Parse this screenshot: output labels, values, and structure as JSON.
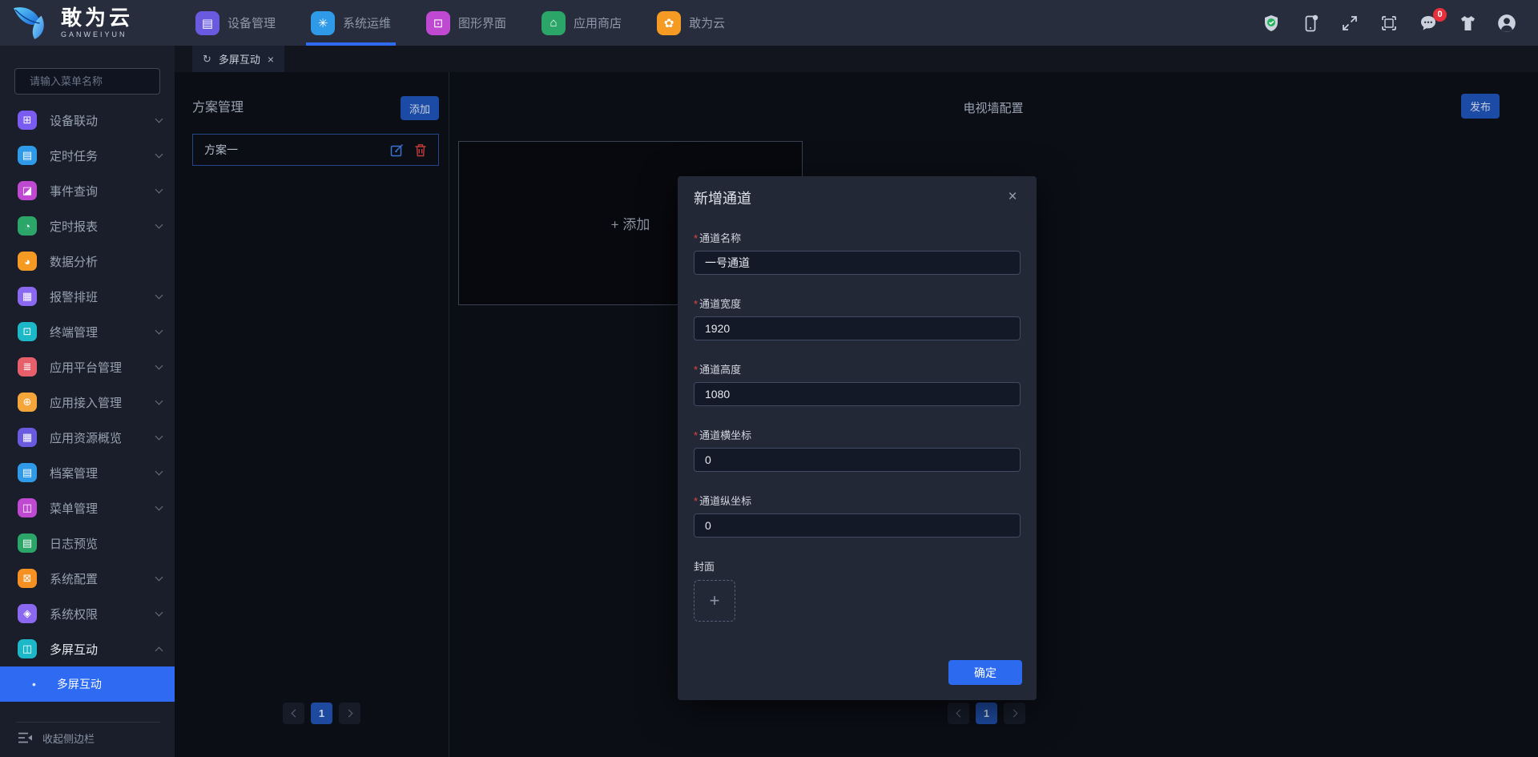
{
  "glyphs": {
    "asterisk": "*",
    "close": "×",
    "plus": "+",
    "refresh": "↻",
    "bullet": "•",
    "tab_close": "×"
  },
  "colors": {
    "accent": "#2e6bf2",
    "primary_button": "#1c4ba6",
    "confirm_button": "#2c6af0",
    "badge": "#e8303c",
    "required": "#e8463c",
    "page_active": "#1d4a9e"
  },
  "navbar": {
    "brand": {
      "title": "敢为云",
      "subtitle": "GANWEIYUN"
    },
    "items": [
      {
        "label": "设备管理",
        "glyph": "▤",
        "color": "#6a5ae0"
      },
      {
        "label": "系统运维",
        "glyph": "✳",
        "color": "#2f9ae8",
        "active": true
      },
      {
        "label": "图形界面",
        "glyph": "⊡",
        "color": "#bf4ad1"
      },
      {
        "label": "应用商店",
        "glyph": "⌂",
        "color": "#2ba568"
      },
      {
        "label": "敢为云",
        "glyph": "✿",
        "color": "#f59a23"
      }
    ],
    "message_badge": "0"
  },
  "sidebar": {
    "search_placeholder": "请输入菜单名称",
    "items": [
      {
        "label": "设备联动",
        "glyph": "⊞",
        "color": "#7a5cf0"
      },
      {
        "label": "定时任务",
        "glyph": "▤",
        "color": "#2f9ae8"
      },
      {
        "label": "事件查询",
        "glyph": "◪",
        "color": "#bf4ad1"
      },
      {
        "label": "定时报表",
        "glyph": "◔",
        "color": "#2ba568"
      },
      {
        "label": "数据分析",
        "glyph": "◕",
        "color": "#f59a23"
      },
      {
        "label": "报警排班",
        "glyph": "▦",
        "color": "#8a68f0"
      },
      {
        "label": "终端管理",
        "glyph": "⊡",
        "color": "#1db8c8"
      },
      {
        "label": "应用平台管理",
        "glyph": "≣",
        "color": "#e65f6b"
      },
      {
        "label": "应用接入管理",
        "glyph": "⊕",
        "color": "#f5a63a"
      },
      {
        "label": "应用资源概览",
        "glyph": "▦",
        "color": "#6a5ae0"
      },
      {
        "label": "档案管理",
        "glyph": "▤",
        "color": "#2f9ae8"
      },
      {
        "label": "菜单管理",
        "glyph": "◫",
        "color": "#bf4ad1"
      },
      {
        "label": "日志预览",
        "glyph": "▤",
        "color": "#2ba568"
      },
      {
        "label": "系统配置",
        "glyph": "⊠",
        "color": "#f59023"
      },
      {
        "label": "系统权限",
        "glyph": "◈",
        "color": "#8a68f0"
      },
      {
        "label": "多屏互动",
        "glyph": "◫",
        "color": "#1db8c8"
      }
    ],
    "submenu_item": "多屏互动",
    "collapse_label": "收起侧边栏"
  },
  "tabbar": {
    "active_tab": "多屏互动"
  },
  "plan_panel": {
    "title": "方案管理",
    "add_button": "添加",
    "rows": [
      {
        "name": "方案一"
      }
    ],
    "page": "1"
  },
  "tv_panel": {
    "title": "电视墙配置",
    "publish_button": "发布",
    "add_tile": "+ 添加",
    "page": "1"
  },
  "modal": {
    "title": "新增通道",
    "fields": [
      {
        "label": "通道名称",
        "value": "一号通道",
        "required": true
      },
      {
        "label": "通道宽度",
        "value": "1920",
        "required": true
      },
      {
        "label": "通道高度",
        "value": "1080",
        "required": true
      },
      {
        "label": "通道横坐标",
        "value": "0",
        "required": true
      },
      {
        "label": "通道纵坐标",
        "value": "0",
        "required": true
      }
    ],
    "cover_label": "封面",
    "confirm_button": "确定"
  }
}
